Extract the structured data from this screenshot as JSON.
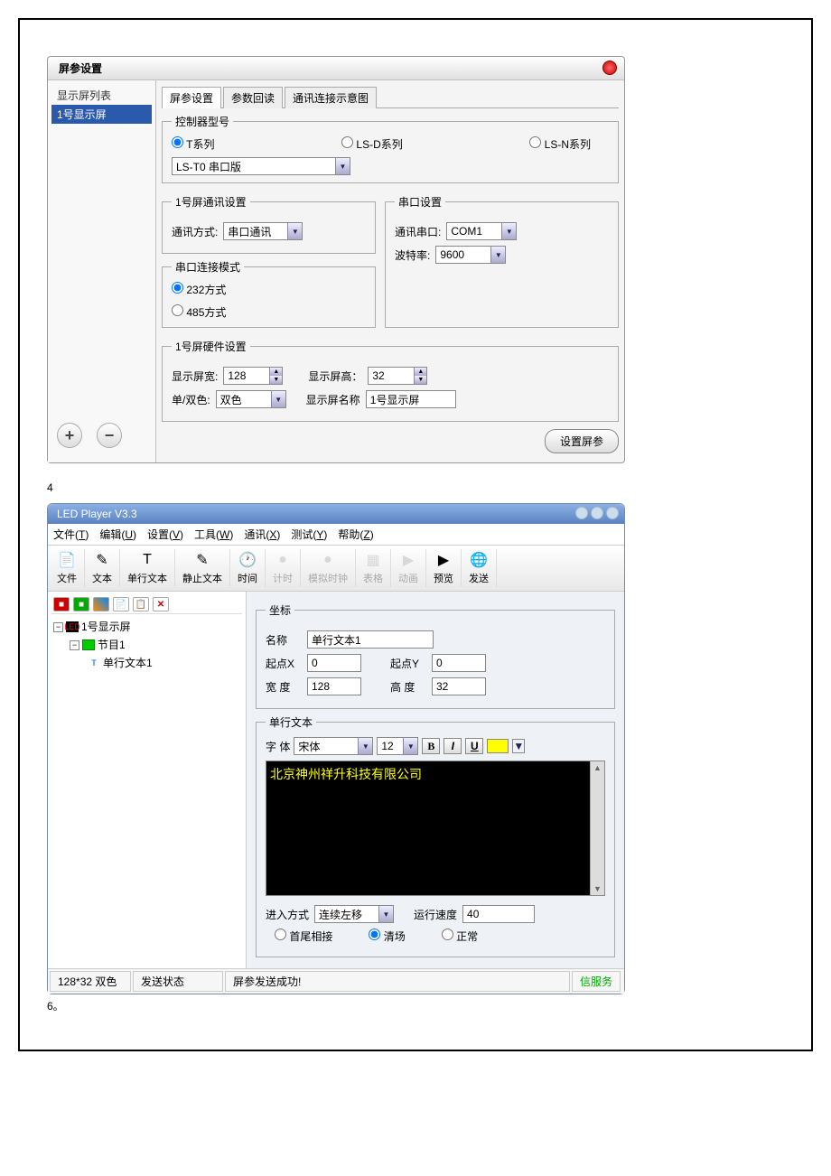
{
  "dialog1": {
    "title": "屏参设置",
    "sidebar": {
      "header": "显示屏列表",
      "items": [
        "1号显示屏"
      ]
    },
    "tabs": [
      "屏参设置",
      "参数回读",
      "通讯连接示意图"
    ],
    "controller": {
      "legend": "控制器型号",
      "options": [
        "T系列",
        "LS-D系列",
        "LS-N系列"
      ],
      "selected": 0,
      "model_value": "LS-T0 串口版"
    },
    "comm": {
      "legend": "1号屏通讯设置",
      "mode_label": "通讯方式:",
      "mode_value": "串口通讯"
    },
    "serial_mode": {
      "legend": "串口连接模式",
      "options": [
        "232方式",
        "485方式"
      ],
      "selected": 0
    },
    "serial_set": {
      "legend": "串口设置",
      "port_label": "通讯串口:",
      "port_value": "COM1",
      "baud_label": "波特率:",
      "baud_value": "9600"
    },
    "hardware": {
      "legend": "1号屏硬件设置",
      "width_label": "显示屏宽:",
      "width_value": "128",
      "height_label": "显示屏高：",
      "height_value": "32",
      "color_label": "单/双色:",
      "color_value": "双色",
      "name_label": "显示屏名称",
      "name_value": "1号显示屏"
    },
    "submit_label": "设置屏参"
  },
  "caption1": "4",
  "app2": {
    "title": "LED Player V3.3",
    "menu": [
      {
        "label": "文件",
        "key": "T"
      },
      {
        "label": "编辑",
        "key": "U"
      },
      {
        "label": "设置",
        "key": "V"
      },
      {
        "label": "工具",
        "key": "W"
      },
      {
        "label": "通讯",
        "key": "X"
      },
      {
        "label": "测试",
        "key": "Y"
      },
      {
        "label": "帮助",
        "key": "Z"
      }
    ],
    "toolbar": [
      {
        "label": "文件",
        "icon": "📄",
        "enabled": true
      },
      {
        "label": "文本",
        "icon": "✎",
        "enabled": true
      },
      {
        "label": "单行文本",
        "icon": "T",
        "enabled": true
      },
      {
        "label": "静止文本",
        "icon": "✎",
        "enabled": true
      },
      {
        "label": "时间",
        "icon": "🕐",
        "enabled": true
      },
      {
        "label": "计时",
        "icon": "●",
        "enabled": false
      },
      {
        "label": "模拟时钟",
        "icon": "●",
        "enabled": false
      },
      {
        "label": "表格",
        "icon": "▦",
        "enabled": false
      },
      {
        "label": "动画",
        "icon": "▶",
        "enabled": false
      },
      {
        "label": "预览",
        "icon": "▶",
        "enabled": true
      },
      {
        "label": "发送",
        "icon": "🌐",
        "enabled": true
      }
    ],
    "tree": {
      "root": "1号显示屏",
      "program": "节目1",
      "item": "单行文本1"
    },
    "coord": {
      "legend": "坐标",
      "name_label": "名称",
      "name_value": "单行文本1",
      "x_label": "起点X",
      "x_value": "0",
      "y_label": "起点Y",
      "y_value": "0",
      "w_label": "宽 度",
      "w_value": "128",
      "h_label": "高 度",
      "h_value": "32"
    },
    "singletext": {
      "legend": "单行文本",
      "font_label": "字   体",
      "font_value": "宋体",
      "size_value": "12",
      "preview_text": "北京神州祥升科技有限公司",
      "enter_label": "进入方式",
      "enter_value": "连续左移",
      "speed_label": "运行速度",
      "speed_value": "40",
      "radio_options": [
        "首尾相接",
        "清场",
        "正常"
      ],
      "radio_selected": 1
    },
    "status": {
      "size": "128*32 双色",
      "send_label": "发送状态",
      "message": "屏参发送成功!",
      "service": "信服务"
    }
  },
  "caption2": "6。"
}
